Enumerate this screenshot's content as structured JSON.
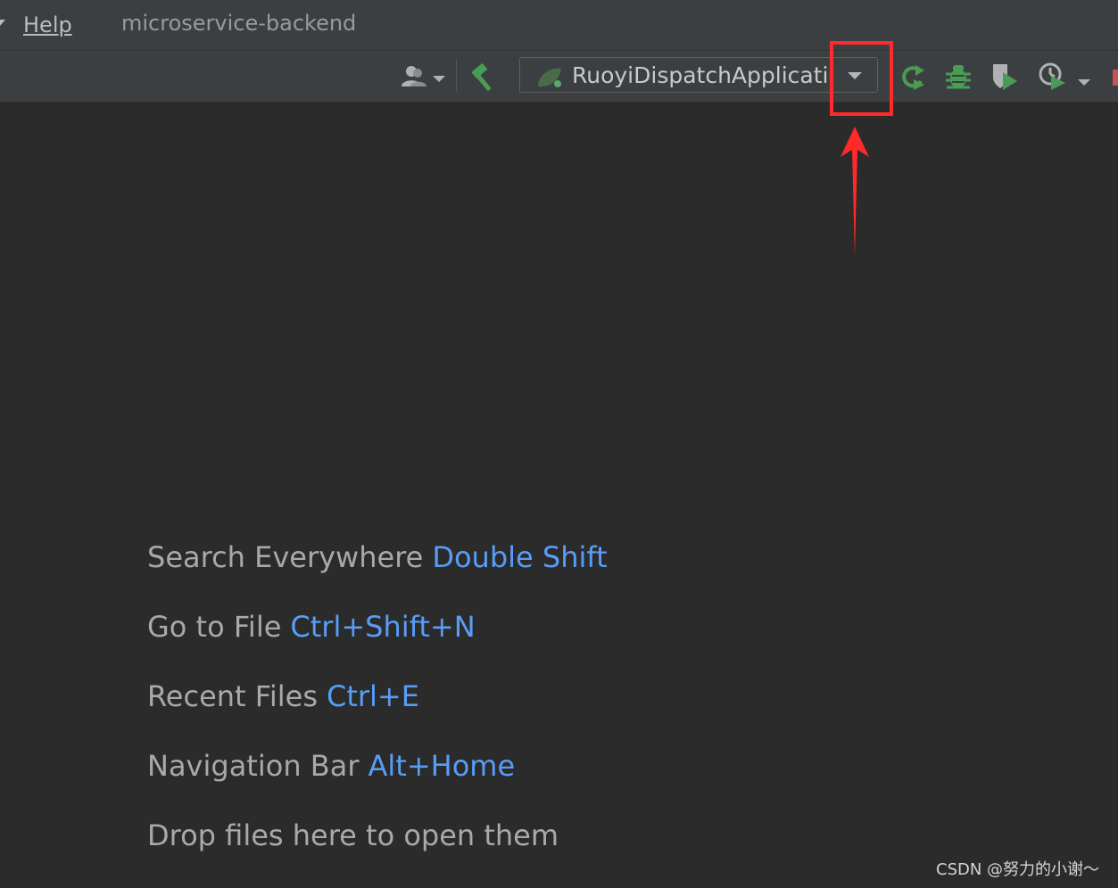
{
  "menubar": {
    "help_label": "Help",
    "project_title": "microservice-backend"
  },
  "toolbar": {
    "run_configuration": "RuoyiDispatchApplication",
    "icons": [
      "user-dropdown-icon",
      "build-hammer-icon",
      "run-config-icon",
      "rerun-icon",
      "debug-icon",
      "coverage-icon",
      "profile-icon",
      "stop-icon"
    ]
  },
  "annotation": {
    "highlight_color": "#ff2a2a"
  },
  "hints": [
    {
      "text": "Search Everywhere",
      "key": "Double Shift"
    },
    {
      "text": "Go to File",
      "key": "Ctrl+Shift+N"
    },
    {
      "text": "Recent Files",
      "key": "Ctrl+E"
    },
    {
      "text": "Navigation Bar",
      "key": "Alt+Home"
    },
    {
      "text": "Drop files here to open them",
      "key": ""
    }
  ],
  "watermark": "CSDN @努力的小谢～",
  "colors": {
    "background": "#2b2b2b",
    "toolbar": "#3c3f41",
    "hint_text": "#a9a9a9",
    "hint_key": "#589df6",
    "green_icons": "#499c54"
  }
}
